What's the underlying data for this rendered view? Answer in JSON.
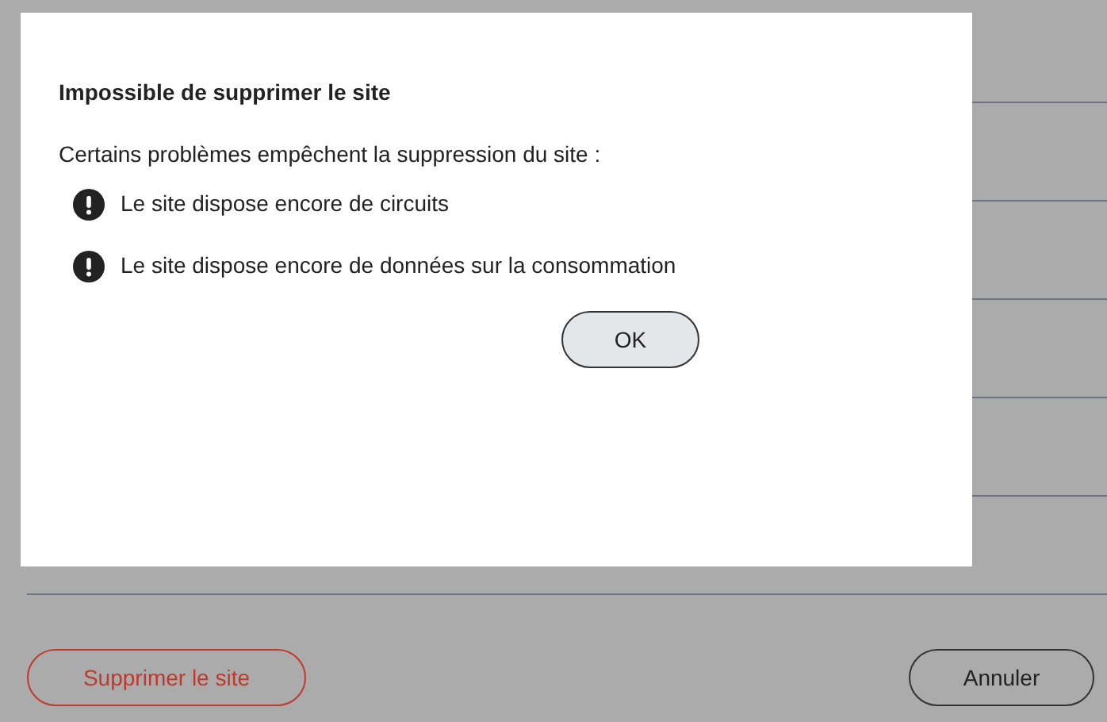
{
  "dialog": {
    "title": "Impossible de supprimer le site",
    "message": "Certains problèmes empêchent la suppression du site :",
    "issues": [
      {
        "text": "Le site dispose encore de circuits"
      },
      {
        "text": "Le site dispose encore de données sur la consommation"
      }
    ],
    "ok_button": "OK"
  },
  "footer": {
    "delete_button": "Supprimer le site",
    "cancel_button": "Annuler"
  }
}
